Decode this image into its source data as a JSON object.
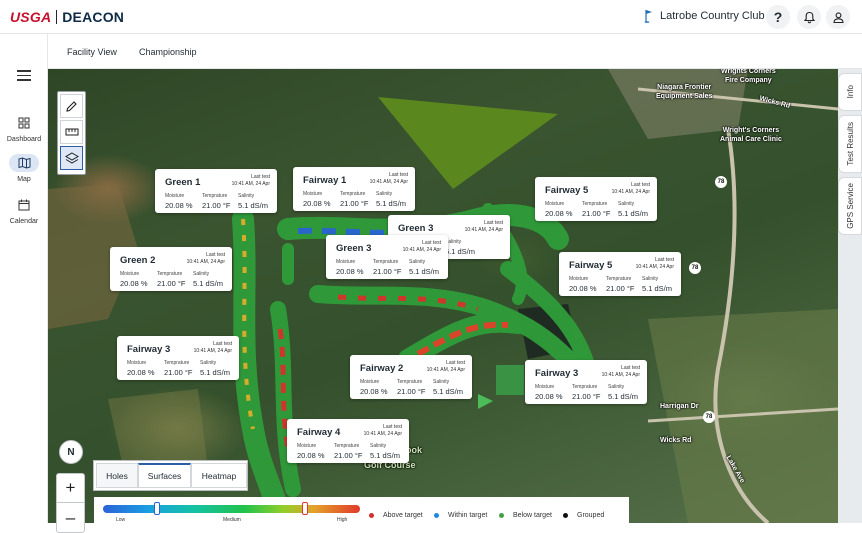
{
  "app": {
    "brand_left": "USGA",
    "brand_right": "DEACON"
  },
  "header": {
    "club_name": "Latrobe Country Club",
    "help_icon": "help-icon",
    "bell_icon": "bell-icon",
    "user_icon": "user-icon"
  },
  "nav": {
    "items": [
      {
        "label": "Dashboard",
        "icon": "dashboard-icon"
      },
      {
        "label": "Map",
        "icon": "map-icon",
        "active": true
      },
      {
        "label": "Calendar",
        "icon": "calendar-icon"
      }
    ]
  },
  "subtabs": [
    "Facility View",
    "Championship"
  ],
  "side_tabs": [
    "Info",
    "Test Results",
    "GPS Service"
  ],
  "map_labels": {
    "wrights_fire": "Wrights Corners\nFire Company",
    "niagara": "Niagara Frontier\nEquipment Sales",
    "wicks_rd_top": "Wicks Rd",
    "animal_clinic": "Wright's Corners\nAnimal Care Clinic",
    "wicks_rd_bottom": "Wicks Rd",
    "harrigan": "Harrigan Dr",
    "lake_ave": "Lake Ave",
    "golf": "Golf Course",
    "brook": "ook",
    "route_78": "78"
  },
  "cards": [
    {
      "title": "Green 1",
      "date": "10:41 AM, 24 Apr"
    },
    {
      "title": "Fairway 1",
      "date": "10:41 AM, 24 Apr"
    },
    {
      "title": "Fairway 5",
      "date": "10:41 AM, 24 Apr"
    },
    {
      "title": "Green 3",
      "date": "10:41 AM, 24 Apr"
    },
    {
      "title": "Green 3",
      "date": "10:41 AM, 24 Apr"
    },
    {
      "title": "Green 2",
      "date": "10:41 AM, 24 Apr"
    },
    {
      "title": "Fairway 5",
      "date": "10:41 AM, 24 Apr"
    },
    {
      "title": "Fairway 3",
      "date": "10:41 AM, 24 Apr"
    },
    {
      "title": "Fairway 2",
      "date": "10:41 AM, 24 Apr"
    },
    {
      "title": "Fairway 3",
      "date": "10:41 AM, 24 Apr"
    },
    {
      "title": "Fairway 4",
      "date": "10:41 AM, 24 Apr"
    }
  ],
  "card_labels": {
    "last_test": "Last test",
    "moisture": "Moisture",
    "temperature": "Temprature",
    "salinity": "Salinity"
  },
  "card_values": {
    "moisture": "20.08 %",
    "temperature": "21.00 °F",
    "salinity": "5.1 dS/m",
    "temperature_partial": "0 °F"
  },
  "compass": "N",
  "zoom": {
    "in": "+",
    "out": "–"
  },
  "view_toggle": [
    "Holes",
    "Surfaces",
    "Heatmap"
  ],
  "legend": {
    "gradient_labels": [
      "Low",
      "Medium",
      "High"
    ],
    "items": [
      {
        "label": "Above target",
        "color": "#d32f2f"
      },
      {
        "label": "Within target",
        "color": "#1e88e5"
      },
      {
        "label": "Below target",
        "color": "#43a047"
      },
      {
        "label": "Grouped",
        "color": "#111111"
      }
    ]
  }
}
